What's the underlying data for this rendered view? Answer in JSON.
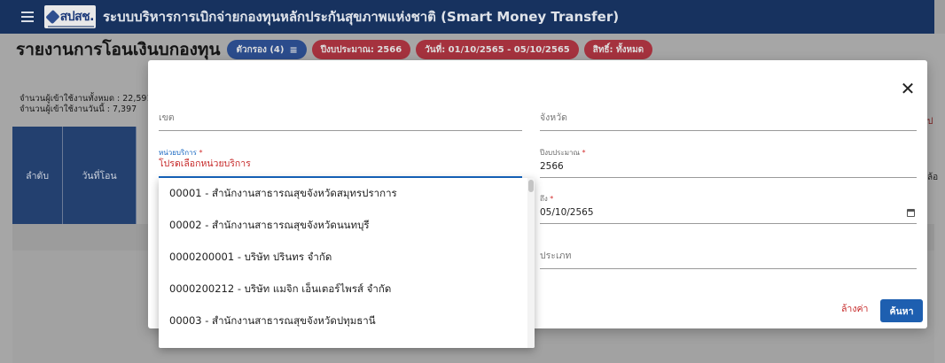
{
  "topbar": {
    "logo_text": "สปสช.",
    "app_title": "ระบบบริหารการเบิกจ่ายกองทุนหลักประกันสุขภาพแห่งชาติ (Smart Money Transfer)"
  },
  "page": {
    "title": "รายงานการโอนเงินบกองทุน",
    "chips": {
      "filter": "ตัวกรอง (4)",
      "fiscal_year": "ปีงบประมาณ: 2566",
      "date_range": "วันที่: 01/10/2565 - 05/10/2565",
      "rights": "สิทธิ์: ทั้งหมด"
    },
    "stats": {
      "total_users": "จำนวนผู้เข้าใช้งานทั้งหมด : 22,591",
      "today_users": "จำนวนผู้เข้าใช้งานวันนี้ : 7,397"
    },
    "table_headers": [
      "ลำดับ",
      "วันที่โอน"
    ],
    "edge_fragments": [
      "ป",
      "ล้อ"
    ]
  },
  "modal": {
    "fields": {
      "zone": {
        "placeholder": "เขต"
      },
      "province": {
        "placeholder": "จังหวัด"
      },
      "service_unit": {
        "label": "หน่วยบริการ",
        "required_mark": "*",
        "value": "โปรดเลือกหน่วยบริการ"
      },
      "fiscal_year": {
        "label": "ปีงบประมาณ",
        "required_mark": "*",
        "value": "2566"
      },
      "to_date": {
        "label": "ถึง",
        "required_mark": "*",
        "value": "05/10/2565"
      },
      "type": {
        "placeholder": "ประเภท"
      }
    },
    "buttons": {
      "clear": "ล้างค่า",
      "search": "ค้นหา"
    },
    "icons": {
      "close": "close-icon",
      "calendar": "calendar-icon"
    },
    "close_symbol": "✕"
  },
  "dropdown": {
    "options": [
      "00001 - สำนักงานสาธารณสุขจังหวัดสมุทรปราการ",
      "00002 - สำนักงานสาธารณสุขจังหวัดนนทบุรี",
      "0000200001 - บริษัท ปรินทร จำกัด",
      "0000200212 - บริษัท แมจิก เอ็นเตอร์ไพรส์ จำกัด",
      "00003 - สำนักงานสาธารณสุขจังหวัดปทุมธานี"
    ]
  }
}
